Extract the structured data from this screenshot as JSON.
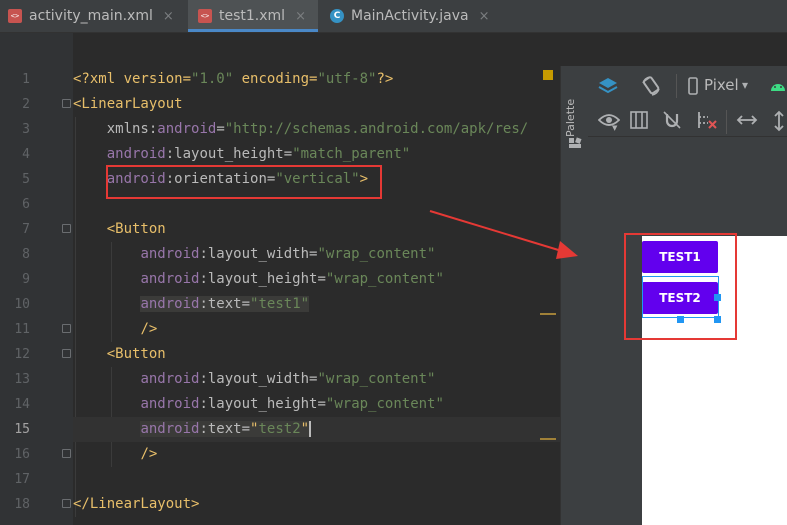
{
  "tabs": [
    {
      "label": "activity_main.xml",
      "icon": "xml-file-icon",
      "close": "×",
      "active": false
    },
    {
      "label": "test1.xml",
      "icon": "xml-file-icon",
      "close": "×",
      "active": true
    },
    {
      "label": "MainActivity.java",
      "icon": "java-class-icon",
      "close": "×",
      "active": false
    }
  ],
  "line_numbers": [
    "1",
    "2",
    "3",
    "4",
    "5",
    "6",
    "7",
    "8",
    "9",
    "10",
    "11",
    "12",
    "13",
    "14",
    "15",
    "16",
    "17",
    "18"
  ],
  "current_line": "15",
  "code": {
    "l1": {
      "decl": "<?xml version=",
      "v1": "\"1.0\"",
      "enc": " encoding=",
      "v2": "\"utf-8\"",
      "end": "?>"
    },
    "l2": {
      "tag": "<LinearLayout"
    },
    "l3": {
      "ns": "xmlns:",
      "attr": "android",
      "eq": "=",
      "val": "\"http://schemas.android.com/apk/res/"
    },
    "l4": {
      "ns": "android",
      "attr": ":layout_height",
      "eq": "=",
      "val": "\"match_parent\""
    },
    "l5": {
      "ns": "android",
      "attr": ":orientation",
      "eq": "=",
      "val": "\"vertical\"",
      "end": ">"
    },
    "l7": {
      "tag": "<Button"
    },
    "l8": {
      "ns": "android",
      "attr": ":layout_width",
      "eq": "=",
      "val": "\"wrap_content\""
    },
    "l9": {
      "ns": "android",
      "attr": ":layout_height",
      "eq": "=",
      "val": "\"wrap_content\""
    },
    "l10": {
      "ns": "android",
      "attr": ":text",
      "eq": "=",
      "val": "\"test1\""
    },
    "l11": {
      "tag": "/>"
    },
    "l12": {
      "tag": "<Button"
    },
    "l13": {
      "ns": "android",
      "attr": ":layout_width",
      "eq": "=",
      "val": "\"wrap_content\""
    },
    "l14": {
      "ns": "android",
      "attr": ":layout_height",
      "eq": "=",
      "val": "\"wrap_content\""
    },
    "l15": {
      "ns": "android",
      "attr": ":text",
      "eq": "=",
      "q1": "\"",
      "val": "test2",
      "q2": "\""
    },
    "l16": {
      "tag": "/>"
    },
    "l18": {
      "tag": "</LinearLayout>"
    }
  },
  "palette_label": "Palette",
  "toolbar": {
    "device": "Pixel",
    "device_chevron": "▾"
  },
  "preview": {
    "button1": "TEST1",
    "button2": "TEST2"
  },
  "colors": {
    "annotation_red": "#e53935",
    "button_purple": "#6200ee",
    "selection_blue": "#2196f3"
  }
}
